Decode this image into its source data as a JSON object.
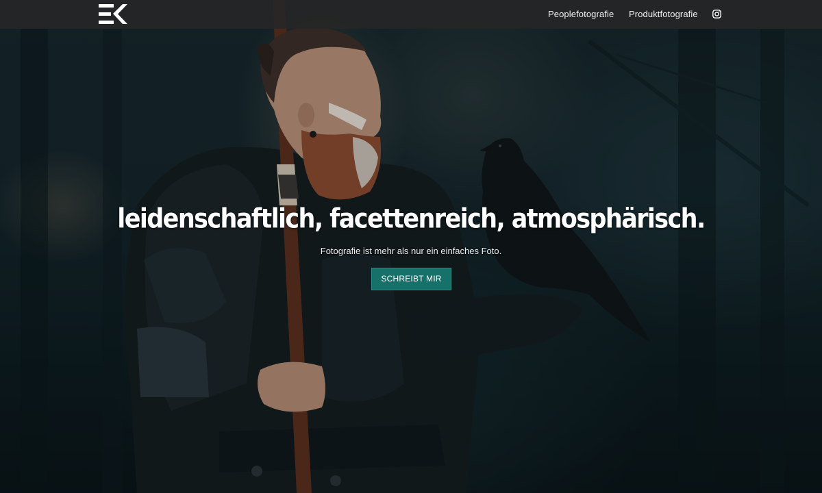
{
  "nav": {
    "logo_text": "EK",
    "links": [
      {
        "label": "Peoplefotografie"
      },
      {
        "label": "Produktfotografie"
      }
    ],
    "social_icon": "instagram-icon"
  },
  "hero": {
    "title": "leidenschaftlich, facettenreich, atmosphärisch.",
    "subtitle": "Fotografie ist mehr als nur ein einfaches Foto.",
    "cta_label": "SCHREIBT MIR",
    "image": "viking-warrior-with-raven-photo"
  },
  "colors": {
    "navbar_bg": "#262626",
    "accent": "#17716b",
    "text": "#ffffff",
    "background": "#0b1416"
  }
}
